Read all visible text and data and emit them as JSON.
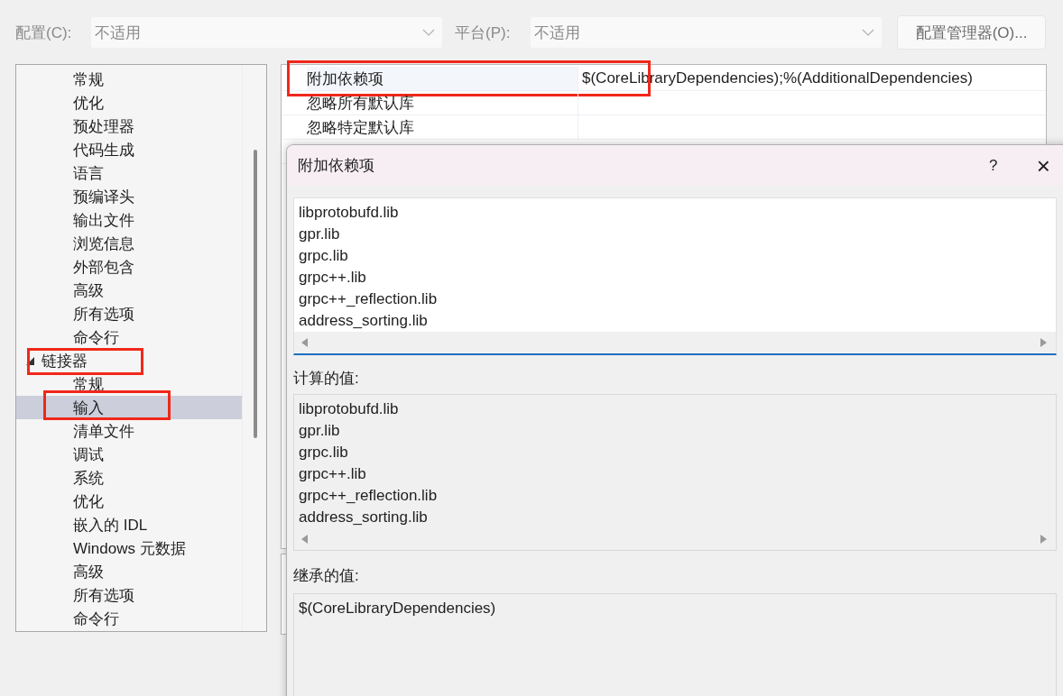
{
  "toolbar": {
    "config_label": "配置(C):",
    "config_value": "不适用",
    "platform_label": "平台(P):",
    "platform_value": "不适用",
    "manager_button": "配置管理器(O)..."
  },
  "tree": [
    {
      "kind": "continued",
      "children": [
        {
          "label": "常规",
          "selected": false,
          "annotated": false
        },
        {
          "label": "优化",
          "selected": false,
          "annotated": false
        },
        {
          "label": "预处理器",
          "selected": false,
          "annotated": false
        },
        {
          "label": "代码生成",
          "selected": false,
          "annotated": false
        },
        {
          "label": "语言",
          "selected": false,
          "annotated": false
        },
        {
          "label": "预编译头",
          "selected": false,
          "annotated": false
        },
        {
          "label": "输出文件",
          "selected": false,
          "annotated": false
        },
        {
          "label": "浏览信息",
          "selected": false,
          "annotated": false
        },
        {
          "label": "外部包含",
          "selected": false,
          "annotated": false
        },
        {
          "label": "高级",
          "selected": false,
          "annotated": false
        },
        {
          "label": "所有选项",
          "selected": false,
          "annotated": false
        },
        {
          "label": "命令行",
          "selected": false,
          "annotated": false
        }
      ]
    },
    {
      "kind": "group",
      "label": "链接器",
      "expanded": true,
      "selected": false,
      "annotated": true,
      "children": [
        {
          "label": "常规",
          "selected": false,
          "annotated": false
        },
        {
          "label": "输入",
          "selected": true,
          "annotated": true
        },
        {
          "label": "清单文件",
          "selected": false,
          "annotated": false
        },
        {
          "label": "调试",
          "selected": false,
          "annotated": false
        },
        {
          "label": "系统",
          "selected": false,
          "annotated": false
        },
        {
          "label": "优化",
          "selected": false,
          "annotated": false
        },
        {
          "label": "嵌入的 IDL",
          "selected": false,
          "annotated": false
        },
        {
          "label": "Windows 元数据",
          "selected": false,
          "annotated": false
        },
        {
          "label": "高级",
          "selected": false,
          "annotated": false
        },
        {
          "label": "所有选项",
          "selected": false,
          "annotated": false
        },
        {
          "label": "命令行",
          "selected": false,
          "annotated": false
        }
      ]
    }
  ],
  "properties": [
    {
      "name": "附加依赖项",
      "value": "$(CoreLibraryDependencies);%(AdditionalDependencies)",
      "selected": true,
      "annotated": true
    },
    {
      "name": "忽略所有默认库",
      "selected": false,
      "annotated": false
    },
    {
      "name": "忽略特定默认库",
      "selected": false,
      "annotated": false
    }
  ],
  "dialog": {
    "title": "附加依赖项",
    "help": "?",
    "close": "×",
    "lines": [
      "libprotobufd.lib",
      "gpr.lib",
      "grpc.lib",
      "grpc++.lib",
      "grpc++_reflection.lib",
      "address_sorting.lib"
    ],
    "computed_label": "计算的值:",
    "computed_lines": [
      "libprotobufd.lib",
      "gpr.lib",
      "grpc.lib",
      "grpc++.lib",
      "grpc++_reflection.lib",
      "address_sorting.lib"
    ],
    "inherited_label": "继承的值:",
    "inherited_lines": [
      "$(CoreLibraryDependencies)"
    ]
  }
}
